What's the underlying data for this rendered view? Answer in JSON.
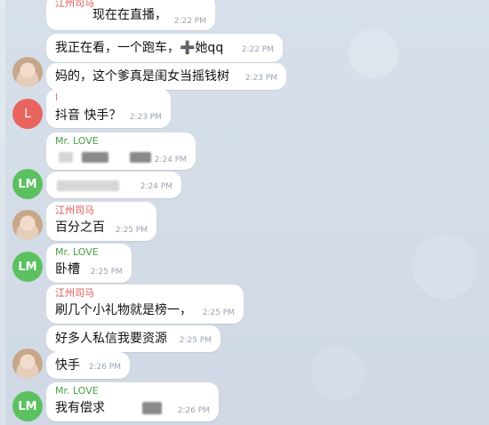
{
  "messages": [
    {
      "sender": "江州司马",
      "text": "现在在直播，",
      "time": "2:22 PM"
    },
    {
      "text": "我正在看，一个跑车，➕她qq",
      "time": "2:22 PM"
    },
    {
      "text": "妈的，这个爹真是闺女当摇钱树",
      "time": "2:23 PM"
    },
    {
      "sender": "l",
      "text": "抖音 快手？",
      "time": "2:23 PM",
      "avatar": "L"
    },
    {
      "sender": "Mr. LOVE",
      "text": "",
      "time": "2:24 PM"
    },
    {
      "text": "",
      "time": "2:24 PM",
      "avatar": "LM"
    },
    {
      "sender": "江州司马",
      "text": "百分之百",
      "time": "2:25 PM"
    },
    {
      "sender": "Mr. LOVE",
      "text": "卧槽",
      "time": "2:25 PM",
      "avatar": "LM"
    },
    {
      "sender": "江州司马",
      "text": "刷几个小礼物就是榜一，",
      "time": "2:25 PM"
    },
    {
      "text": "好多人私信我要资源",
      "time": "2:25 PM"
    },
    {
      "text": "快手",
      "time": "2:26 PM"
    },
    {
      "sender": "Mr. LOVE",
      "text": "我有偿求",
      "time": "2:26 PM",
      "avatar": "LM"
    }
  ]
}
